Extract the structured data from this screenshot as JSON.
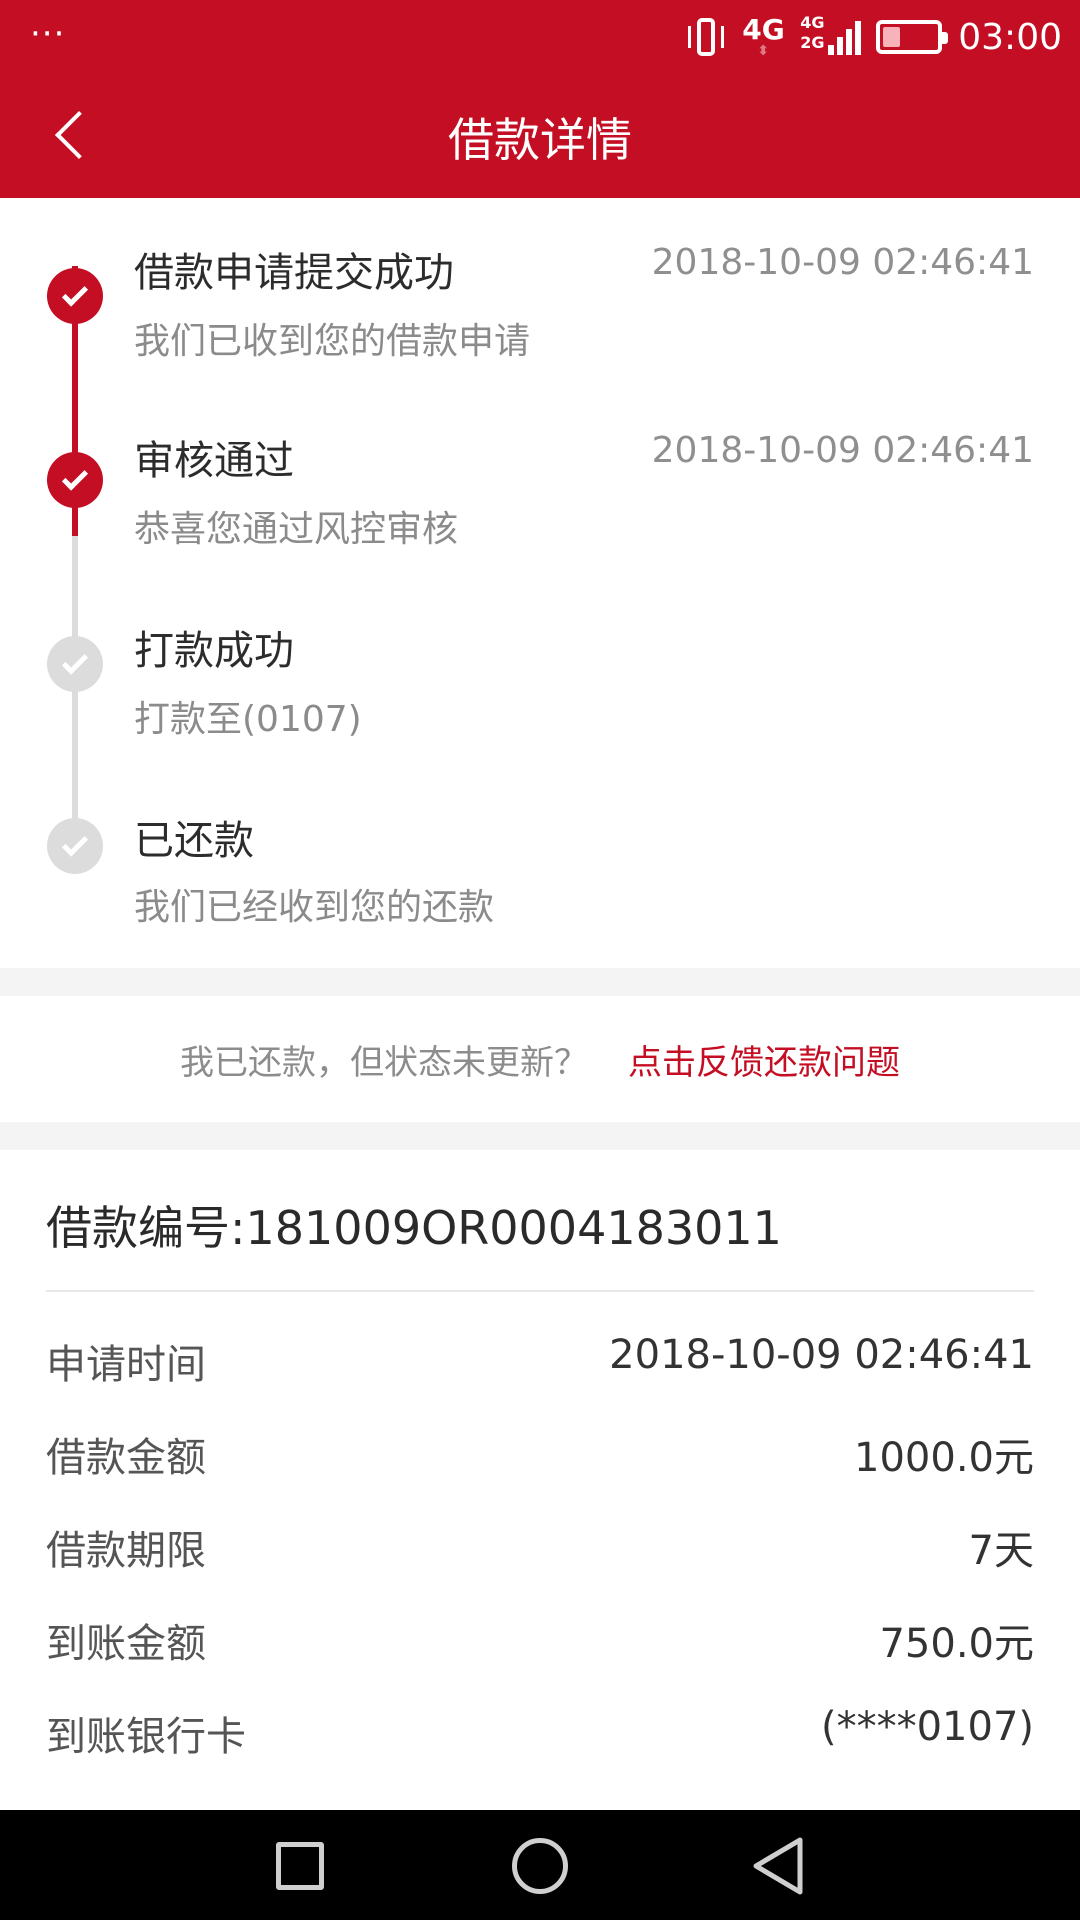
{
  "status_bar": {
    "menu_dots": "···",
    "network_label": "4G",
    "signal_label_top": "4G",
    "signal_label_bottom": "2G",
    "battery_level": 0.3,
    "time": "03:00"
  },
  "nav": {
    "title": "借款详情",
    "back_icon": "chevron-left-icon"
  },
  "timeline": [
    {
      "title": "借款申请提交成功",
      "desc": "我们已收到您的借款申请",
      "time": "2018-10-09 02:46:41",
      "done": true
    },
    {
      "title": "审核通过",
      "desc": "恭喜您通过风控审核",
      "time": "2018-10-09 02:46:41",
      "done": true
    },
    {
      "title": "打款成功",
      "desc": "打款至(0107)",
      "time": "",
      "done": false
    },
    {
      "title": "已还款",
      "desc": "我们已经收到您的还款",
      "time": "",
      "done": false
    }
  ],
  "feedback": {
    "question": "我已还款，但状态未更新？",
    "link": "点击反馈还款问题"
  },
  "detail": {
    "loan_number": "借款编号:181009OR0004183011",
    "rows": [
      {
        "key": "申请时间",
        "value": "2018-10-09 02:46:41"
      },
      {
        "key": "借款金额",
        "value": "1000.0元"
      },
      {
        "key": "借款期限",
        "value": "7天"
      },
      {
        "key": "到账金额",
        "value": "750.0元"
      },
      {
        "key": "到账银行卡",
        "value": "(****0107)"
      }
    ]
  },
  "colors": {
    "brand": "#c40e23",
    "done": "#c40e23",
    "pending": "#dcdcdc"
  },
  "system_nav": {
    "recents_icon": "square-icon",
    "home_icon": "circle-icon",
    "back_icon": "triangle-back-icon"
  }
}
